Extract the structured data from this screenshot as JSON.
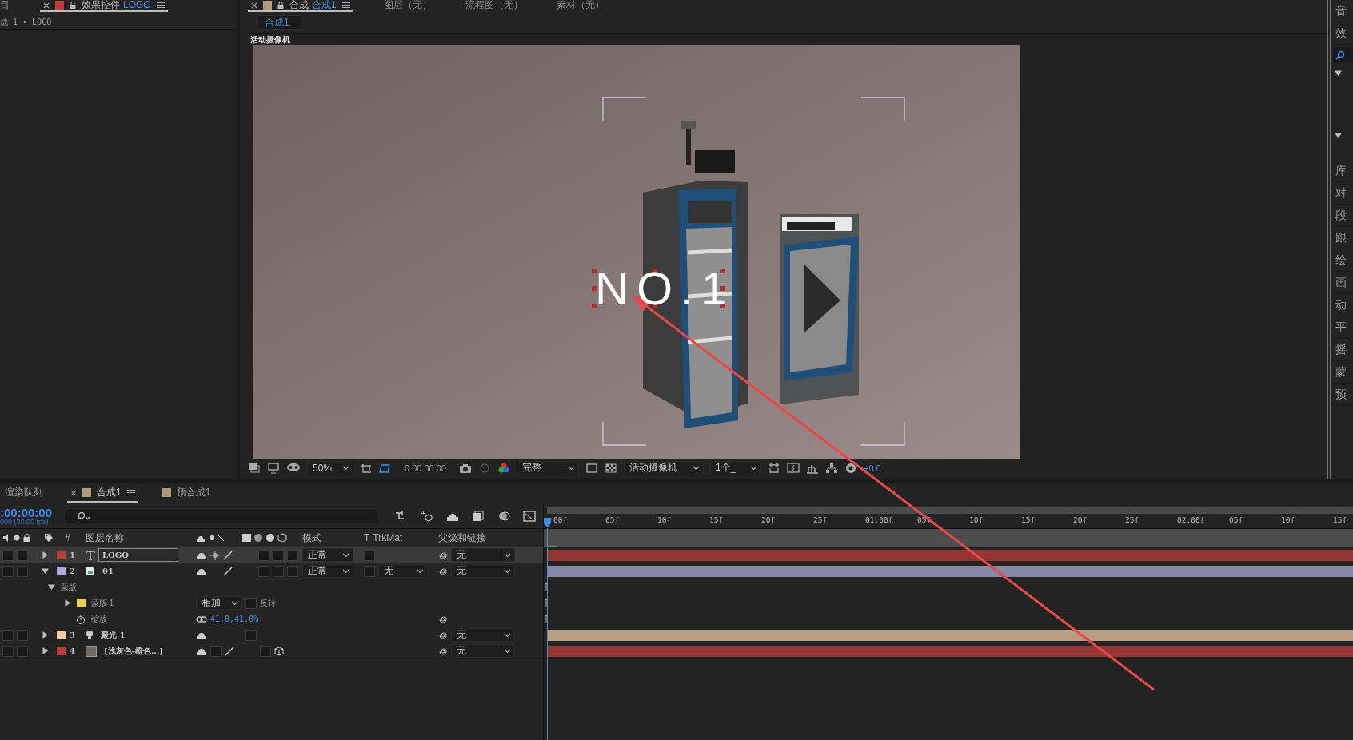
{
  "left_panel": {
    "tabs": [
      {
        "label": "目",
        "selected": false
      },
      {
        "label": "效果控件",
        "sublabel": "LOGO",
        "selected": true
      }
    ],
    "breadcrumb": "成 1 • LOGO"
  },
  "viewer": {
    "tabs": [
      {
        "label": "合成",
        "sublabel": "合成1",
        "selected": true
      },
      {
        "label": "图层（无）",
        "selected": false
      },
      {
        "label": "流程图（无）",
        "selected": false
      },
      {
        "label": "素材（无）",
        "selected": false
      }
    ],
    "comp_button": "合成1",
    "camera_label": "活动摄像机",
    "text_layer": "NO.1",
    "toolbar": {
      "zoom": "50%",
      "timecode": "0:00:00:00",
      "resolution": "完整",
      "camera": "活动摄像机",
      "views": "1个_",
      "exposure": "+0.0"
    }
  },
  "right_panel": {
    "top_items": [
      "音",
      "效"
    ],
    "sections": [
      {
        "expanded": true
      },
      {
        "expanded": true
      }
    ],
    "items": [
      "库",
      "对",
      "段",
      "跟",
      "绘",
      "画",
      "动",
      "平",
      "摇",
      "蒙",
      "预"
    ]
  },
  "timeline": {
    "tabs": [
      {
        "label": "渲染队列",
        "kind": "queue",
        "selected": false
      },
      {
        "label": "合成1",
        "kind": "comp",
        "selected": true
      },
      {
        "label": "预合成1",
        "kind": "comp",
        "selected": false
      }
    ],
    "timecode": ":00:00:00",
    "fps": "000 (30.00 fps)",
    "columns": {
      "number": "#",
      "name": "图层名称",
      "mode": "模式",
      "t": "T",
      "trkmat": "TrkMat",
      "parent": "父级和链接"
    },
    "layers": [
      {
        "number": "1",
        "name": "LOGO",
        "kind": "text",
        "color": "#c0393b",
        "expanded": false,
        "selected": true,
        "is_3d": false,
        "mode": "正常",
        "parent": "无"
      },
      {
        "number": "2",
        "name": "01",
        "kind": "footage",
        "color": "#a9a9d4",
        "expanded": true,
        "selected": false,
        "is_3d": false,
        "mode": "正常",
        "trkmat": "无",
        "parent": "无",
        "children": [
          {
            "kind": "group",
            "name": "蒙版",
            "expanded": true,
            "children": [
              {
                "kind": "mask",
                "name": "蒙版 1",
                "expanded": false,
                "mode": "相加",
                "invert_label": "反转",
                "inverted": false
              }
            ]
          },
          {
            "kind": "property",
            "name": "缩放",
            "value": "41.0,41.0%"
          }
        ]
      },
      {
        "number": "3",
        "name": "聚光 1",
        "kind": "light",
        "color": "#f2c8a2",
        "expanded": false,
        "selected": false,
        "is_3d": false,
        "parent": "无"
      },
      {
        "number": "4",
        "name": "[浅灰色-橙色...]",
        "kind": "solid",
        "color": "#c0393b",
        "expanded": false,
        "selected": false,
        "is_3d": true,
        "parent": "无"
      }
    ],
    "ruler": [
      "00f",
      "05f",
      "10f",
      "15f",
      "20f",
      "25f",
      "01:00f",
      "05f",
      "10f",
      "15f",
      "20f",
      "25f",
      "02:00f",
      "05f",
      "10f",
      "15f"
    ]
  }
}
